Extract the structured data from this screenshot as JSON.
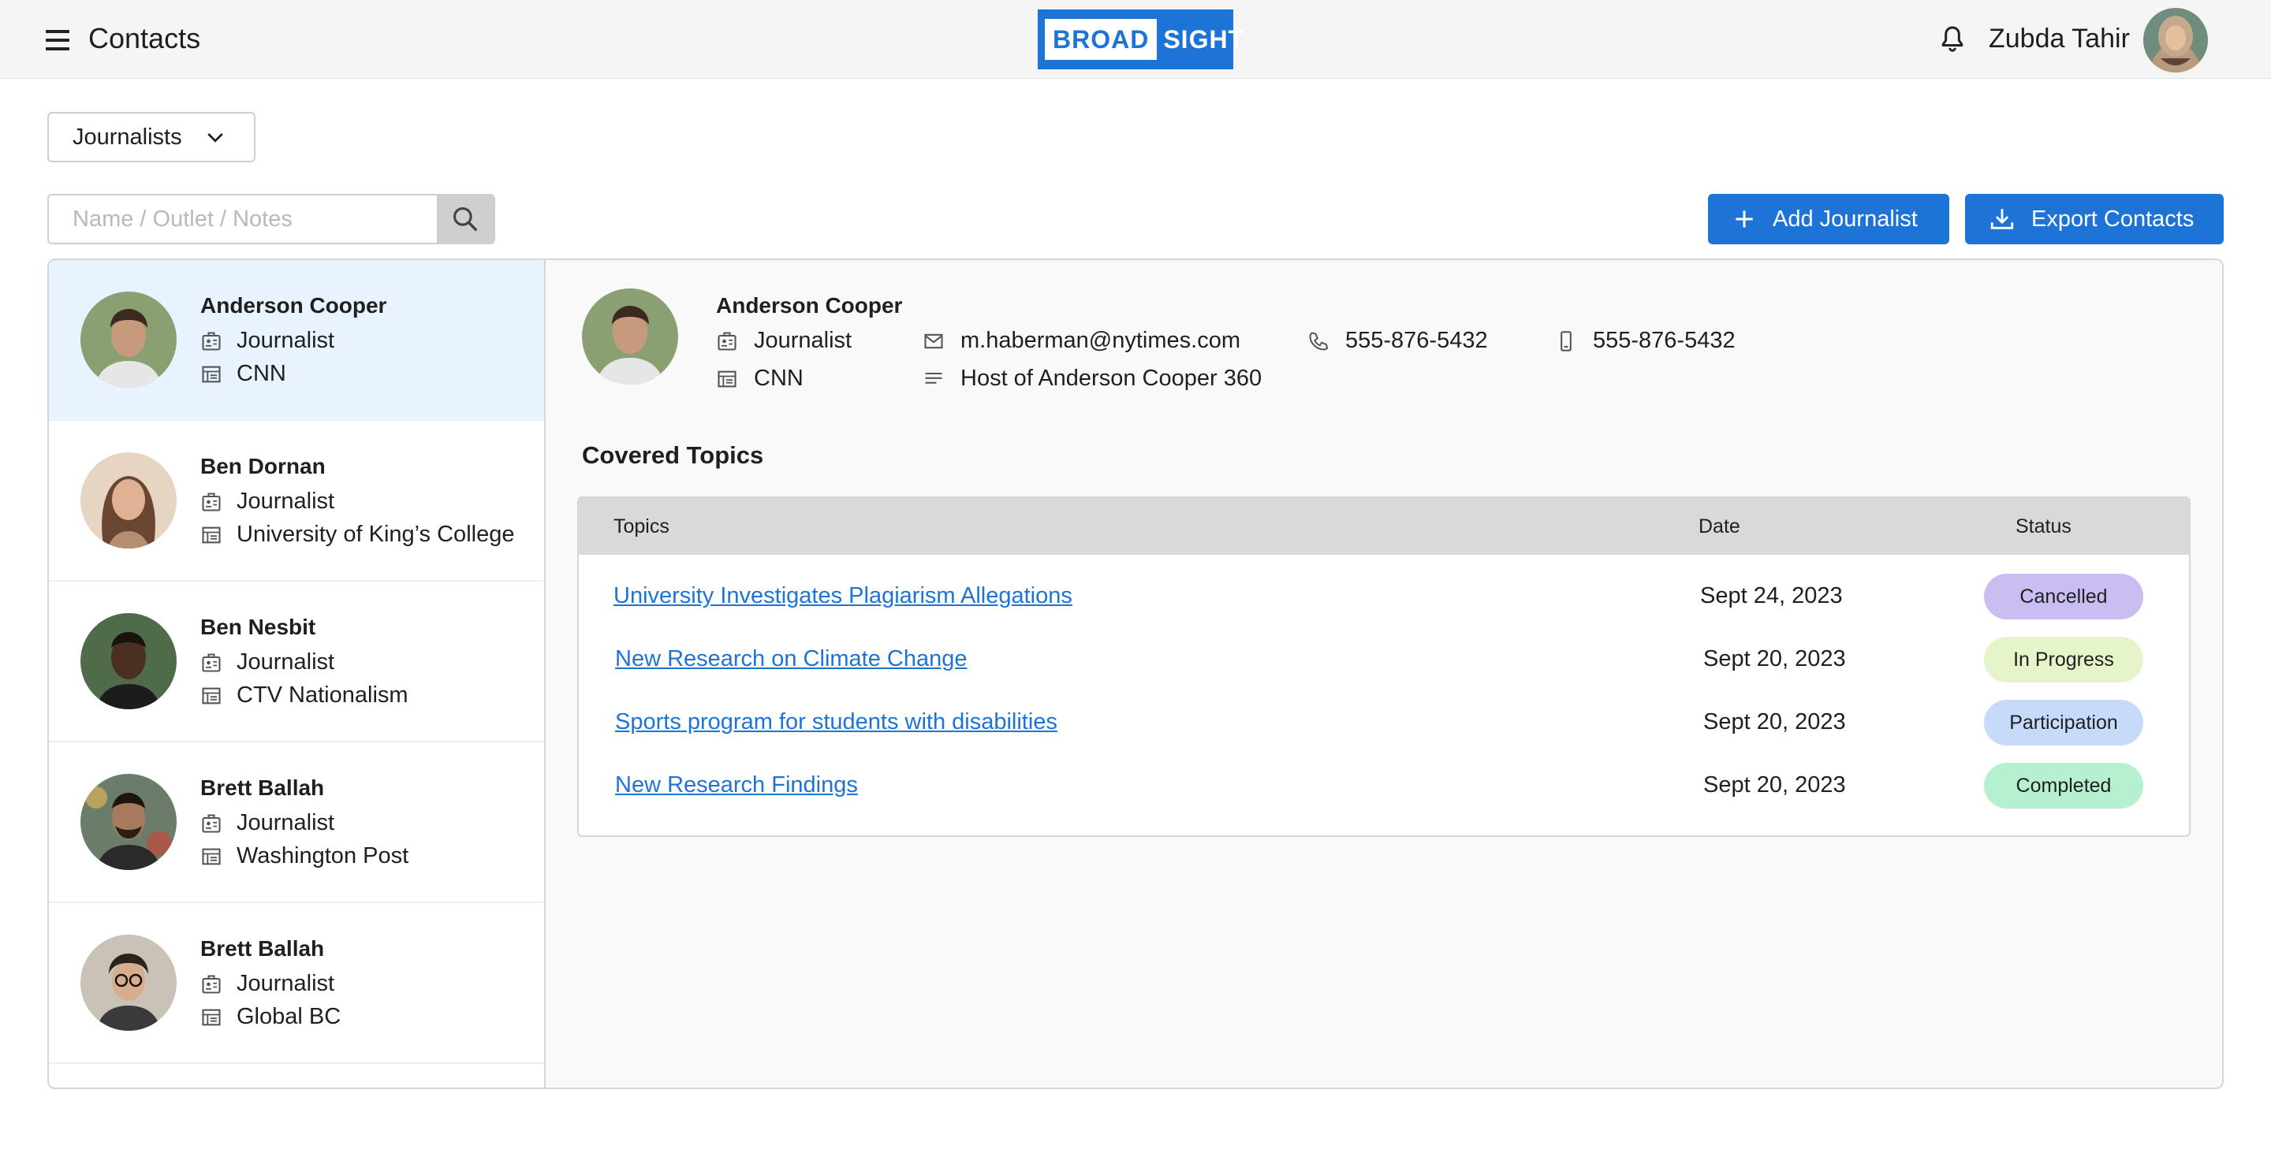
{
  "header": {
    "title": "Contacts",
    "logo_left": "BROAD",
    "logo_right": "SIGHT",
    "user_name": "Zubda Tahir"
  },
  "filter": {
    "selected": "Journalists"
  },
  "search": {
    "placeholder": "Name / Outlet / Notes",
    "value": ""
  },
  "actions": {
    "add_label": "Add Journalist",
    "export_label": "Export Contacts"
  },
  "contacts": [
    {
      "name": "Anderson Cooper",
      "role": "Journalist",
      "outlet": "CNN",
      "selected": true
    },
    {
      "name": "Ben Dornan",
      "role": "Journalist",
      "outlet": "University of King’s College"
    },
    {
      "name": "Ben Nesbit",
      "role": "Journalist",
      "outlet": "CTV Nationalism"
    },
    {
      "name": "Brett Ballah",
      "role": "Journalist",
      "outlet": "Washington Post"
    },
    {
      "name": "Brett Ballah",
      "role": "Journalist",
      "outlet": "Global BC"
    }
  ],
  "detail": {
    "name": "Anderson Cooper",
    "role": "Journalist",
    "outlet": "CNN",
    "email": "m.haberman@nytimes.com",
    "note": "Host of Anderson Cooper 360",
    "phone": "555-876-5432",
    "mobile": "555-876-5432"
  },
  "topics": {
    "title": "Covered Topics",
    "columns": {
      "topics": "Topics",
      "date": "Date",
      "status": "Status"
    },
    "rows": [
      {
        "topic": "University Investigates Plagiarism Allegations",
        "date": "Sept 24, 2023",
        "status": "Cancelled",
        "status_color": "#c9bdf2"
      },
      {
        "topic": "New Research on Climate Change",
        "date": "Sept 20, 2023",
        "status": "In Progress",
        "status_color": "#e6f5c9"
      },
      {
        "topic": "Sports program for students with disabilities",
        "date": "Sept 20, 2023",
        "status": "Participation",
        "status_color": "#c7daf9"
      },
      {
        "topic": "New Research Findings",
        "date": "Sept 20, 2023",
        "status": "Completed",
        "status_color": "#b5f0d0"
      }
    ]
  },
  "colors": {
    "accent": "#1e74d6",
    "selected_row": "#e8f3ff"
  }
}
